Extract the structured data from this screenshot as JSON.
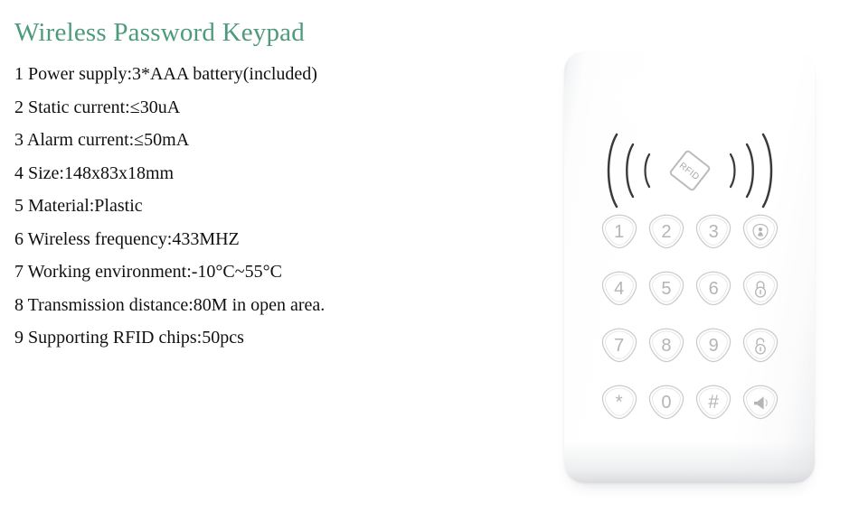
{
  "product": {
    "title": "Wireless Password Keypad",
    "title_color": "#4d9b7c",
    "specs": [
      "1 Power supply:3*AAA battery(included)",
      "2 Static current:≤30uA",
      "3 Alarm current:≤50mA",
      "4 Size:148x83x18mm",
      "5 Material:Plastic",
      "6 Wireless frequency:433MHZ",
      "7 Working environment:-10°C~55°C",
      "8 Transmission distance:80M in open area.",
      "9 Supporting RFID chips:50pcs"
    ]
  },
  "device": {
    "body_color": "#ffffff",
    "key_outline_color": "#c9cbce",
    "key_glyph_color": "#b3b5b8",
    "rfid": {
      "badge_label": "RFID",
      "wave_color": "#3a3a3e",
      "left_arcs": 3,
      "right_arcs": 3
    },
    "keys": [
      {
        "label": "1",
        "icon": null,
        "name": "key-1"
      },
      {
        "label": "2",
        "icon": null,
        "name": "key-2"
      },
      {
        "label": "3",
        "icon": null,
        "name": "key-3"
      },
      {
        "label": "",
        "icon": "home-arm-icon",
        "name": "key-home-arm"
      },
      {
        "label": "4",
        "icon": null,
        "name": "key-4"
      },
      {
        "label": "5",
        "icon": null,
        "name": "key-5"
      },
      {
        "label": "6",
        "icon": null,
        "name": "key-6"
      },
      {
        "label": "",
        "icon": "lock-closed-icon",
        "name": "key-arm-lock"
      },
      {
        "label": "7",
        "icon": null,
        "name": "key-7"
      },
      {
        "label": "8",
        "icon": null,
        "name": "key-8"
      },
      {
        "label": "9",
        "icon": null,
        "name": "key-9"
      },
      {
        "label": "",
        "icon": "lock-open-icon",
        "name": "key-disarm-unlock"
      },
      {
        "label": "*",
        "icon": null,
        "name": "key-star"
      },
      {
        "label": "0",
        "icon": null,
        "name": "key-0"
      },
      {
        "label": "#",
        "icon": null,
        "name": "key-hash"
      },
      {
        "label": "",
        "icon": "speaker-icon",
        "name": "key-sos-speaker"
      }
    ]
  }
}
